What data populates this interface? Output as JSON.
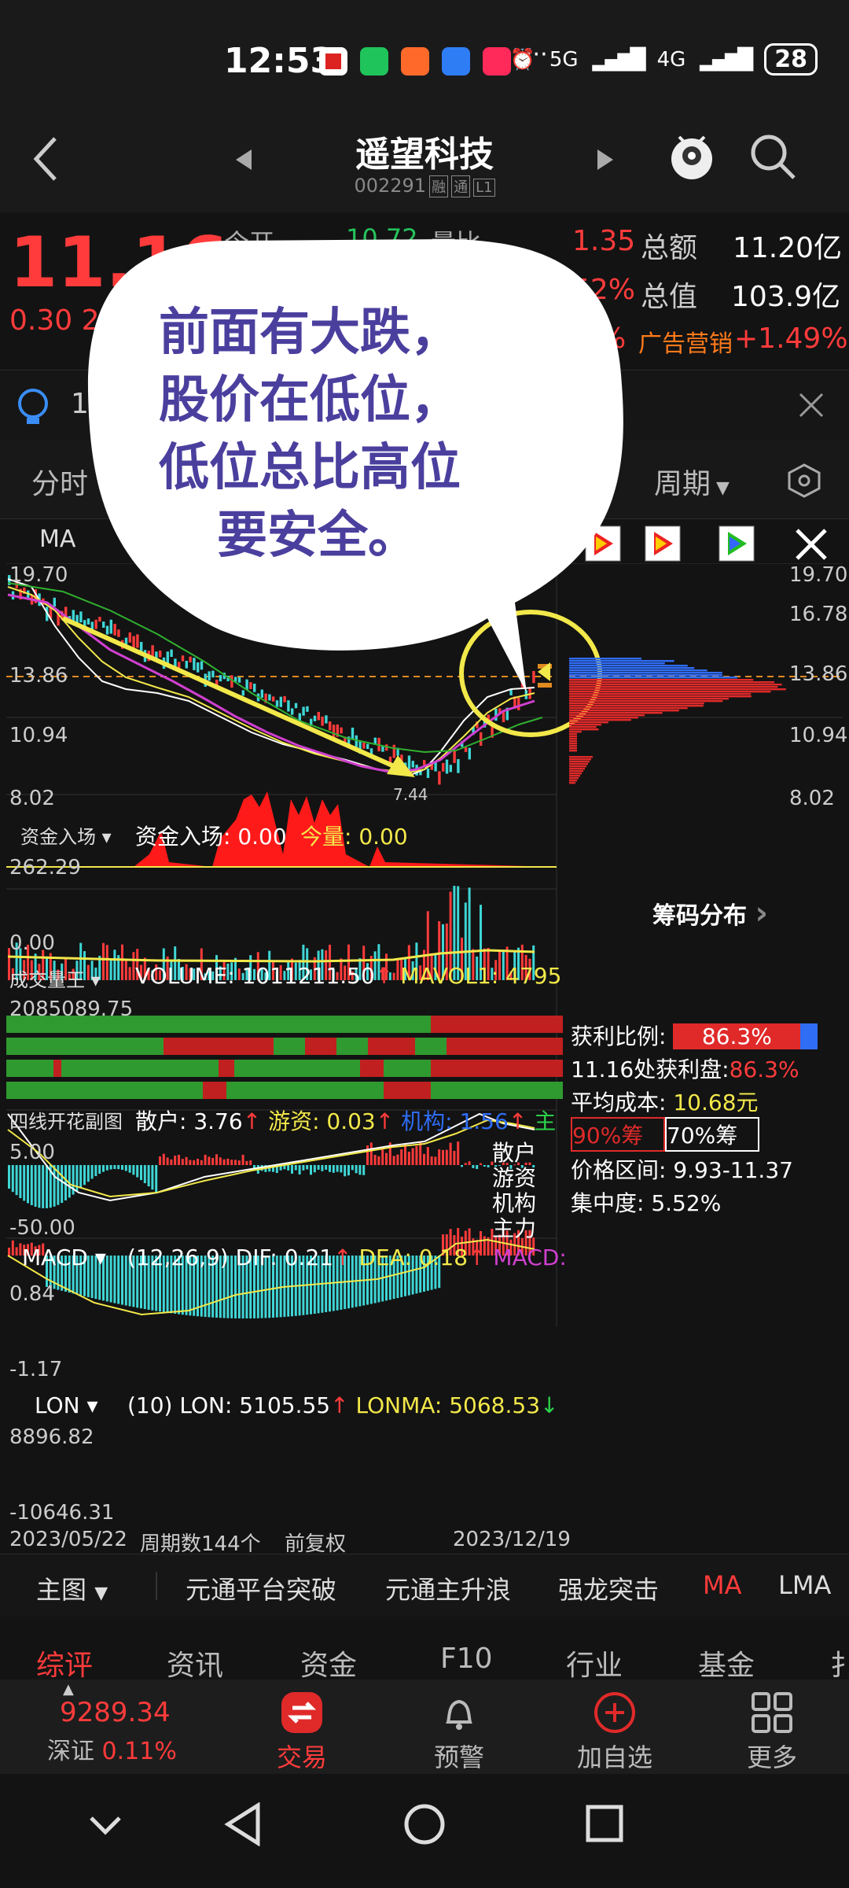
{
  "status": {
    "time": "12:53",
    "net1": "5G",
    "net2": "4G",
    "battery": "28",
    "more": "···"
  },
  "header": {
    "title": "遥望科技",
    "code": "002291",
    "tags": [
      "融",
      "通",
      "L1"
    ]
  },
  "quote": {
    "price": "11.16",
    "change": "0.30",
    "change_pct_partial": "2",
    "k1": "今开",
    "v1": "10.72",
    "k2": "量比",
    "r1_val": "1.35",
    "r1_key": "总额",
    "r1_val2": "11.20亿",
    "r2_val": "52%",
    "r2_key": "总值",
    "r2_val2": "103.9亿",
    "r3_val": "%",
    "r3_key": "广告营销",
    "r3_val2": "+1.49%"
  },
  "notice": {
    "text": "1"
  },
  "tabs": {
    "fenshi": "分时",
    "period": "周期"
  },
  "bubble": {
    "line1": "前面有大跌，",
    "line2": "股价在低位，",
    "line3": "低位总比高位",
    "line4": "要安全。"
  },
  "chart": {
    "ma_label": "MA",
    "y_ticks": [
      "19.70",
      "16.78",
      "13.86",
      "10.94",
      "8.02"
    ],
    "left_ticks": [
      "19.70",
      "13.86",
      "10.94",
      "8.02"
    ],
    "low_marker": "7.44",
    "fund": {
      "name": "资金入场",
      "label": "资金入场: 0.00",
      "today": "今量: 0.00",
      "top": "262.29",
      "bottom": "0.00"
    },
    "volume": {
      "name": "成交量王",
      "label": "VOLUME: 1011211.50",
      "arrow": "↑",
      "mavol": "MAVOL1: 4795",
      "top": "2085089.75"
    },
    "fourline": {
      "name": "四线开花副图",
      "s": "散户: 3.76",
      "y": "游资: 0.03",
      "j": "机构: 1.56",
      "z": "主",
      "top": "5.00",
      "bottom": "-50.00",
      "legend": [
        "散户",
        "游资",
        "机构",
        "主力"
      ]
    },
    "macd": {
      "name": "MACD",
      "params": "(12,26,9)",
      "dif": "DIF: 0.21",
      "dea": "DEA: 0.18",
      "macd": "MACD:",
      "top": "0.84",
      "bottom": "-1.17"
    },
    "lon": {
      "name": "LON",
      "params": "(10)",
      "lon": "LON: 5105.55",
      "lonma": "LONMA: 5068.53",
      "top": "8896.82",
      "bottom": "-10646.31"
    },
    "footer": {
      "start": "2023/05/22",
      "count": "周期数144个",
      "adj": "前复权",
      "end": "2023/12/19"
    }
  },
  "chips": {
    "title": "筹码分布",
    "profit_ratio_label": "获利比例:",
    "profit_ratio": "86.3%",
    "profit_at_label": "11.16处获利盘:",
    "profit_at": "86.3%",
    "avg_cost_label": "平均成本:",
    "avg_cost": "10.68元",
    "btn90": "90%筹",
    "btn70": "70%筹",
    "range_label": "价格区间:",
    "range": "9.93-11.37",
    "conc_label": "集中度:",
    "conc": "5.52%"
  },
  "menu1": {
    "main": "主图",
    "items": [
      "元通平台突破",
      "元通主升浪",
      "强龙突击",
      "MA",
      "LMA"
    ]
  },
  "menu2": {
    "items": [
      "综评",
      "资讯",
      "资金",
      "F10",
      "行业",
      "基金",
      "扌"
    ]
  },
  "bottomnav": {
    "index_val": "9289.34",
    "index_name": "深证",
    "index_pct": "0.11%",
    "trade": "交易",
    "alert": "预警",
    "add": "加自选",
    "more": "更多"
  },
  "colors": {
    "up": "#ff3b3b",
    "down": "#3fd6d6",
    "yellow": "#f2e84a",
    "accent_purple": "#4b3f9e"
  }
}
